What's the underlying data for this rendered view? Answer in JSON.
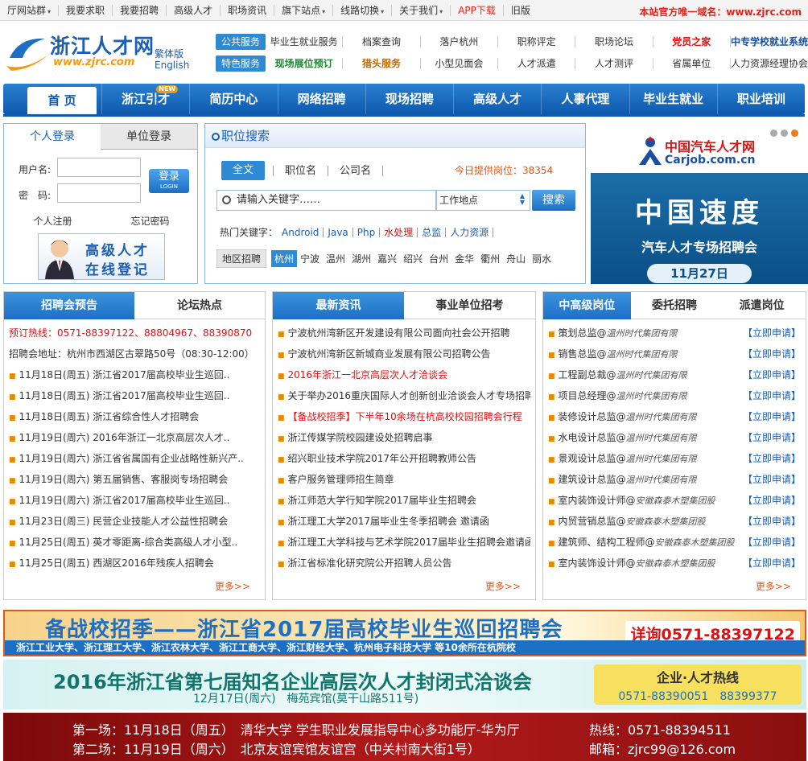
{
  "topbar": {
    "items": [
      {
        "label": "厅网站群",
        "dd": true
      },
      {
        "label": "我要求职",
        "dd": false
      },
      {
        "label": "我要招聘",
        "dd": false
      },
      {
        "label": "高级人才",
        "dd": false
      },
      {
        "label": "职场资讯",
        "dd": false
      },
      {
        "label": "旗下站点",
        "dd": true
      },
      {
        "label": "线路切换",
        "dd": true
      },
      {
        "label": "关于我们",
        "dd": true
      },
      {
        "label": "APP下载",
        "dd": false
      },
      {
        "label": "旧版",
        "dd": false
      }
    ],
    "domain_notice": "本站官方唯一域名：www.zjrc.com"
  },
  "logo": {
    "name": "浙江人才网",
    "url": "www.zjrc.com",
    "trad": "繁体版",
    "eng": "English"
  },
  "services": {
    "row1_tag": "公共服务",
    "row1": [
      "毕业生就业服务",
      "档案查询",
      "落户杭州",
      "职称评定",
      "职场论坛",
      "党员之家",
      "中专学校就业系统"
    ],
    "row2_tag": "特色服务",
    "row2": [
      "现场展位预订",
      "猎头服务",
      "小型见面会",
      "人才派遣",
      "人才测评",
      "省属单位",
      "人力资源经理协会"
    ]
  },
  "nav": {
    "items": [
      "首 页",
      "浙江引才",
      "简历中心",
      "网络招聘",
      "现场招聘",
      "高级人才",
      "人事代理",
      "毕业生就业",
      "职业培训"
    ],
    "new_badge": "NEW"
  },
  "login": {
    "tabs": [
      "个人登录",
      "单位登录"
    ],
    "user_label": "用户名:",
    "pass_label": "密　码:",
    "button": "登录",
    "button_sub": "LOGIN",
    "register": "个人注册",
    "forgot": "忘记密码",
    "banner_line1": "高级人才",
    "banner_line2": "在线登记"
  },
  "search": {
    "title": "职位搜索",
    "tabs": [
      "全文",
      "职位名",
      "公司名"
    ],
    "count_label": "今日提供岗位：",
    "count": "38354",
    "placeholder": "请输入关键字……",
    "location": "工作地点",
    "button": "搜索",
    "hot_label": "热门关键字：",
    "hot": [
      "Android",
      "Java",
      "Php",
      "水处理",
      "总监",
      "人力资源"
    ],
    "hot_red": [
      false,
      false,
      false,
      true,
      false,
      false
    ],
    "region_label": "地区招聘",
    "regions": [
      "杭州",
      "宁波",
      "温州",
      "湖州",
      "嘉兴",
      "绍兴",
      "台州",
      "金华",
      "衢州",
      "舟山",
      "丽水"
    ]
  },
  "ad": {
    "brand": "中国汽车人才网",
    "brand_url": "Carjob.com.cn",
    "title": "中国速度",
    "subtitle": "汽车人才专场招聘会",
    "date": "11月27日"
  },
  "panel1": {
    "tabs": [
      "招聘会预告",
      "论坛热点"
    ],
    "hotline": "预订热线：0571-88397122、88804967、88390870",
    "address": "招聘会地址：杭州市西湖区古翠路50号（08:30-12:00）",
    "rows": [
      "11月18日(周五) 浙江省2017届高校毕业生巡回..",
      "11月18日(周五) 浙江省2017届高校毕业生巡回..",
      "11月18日(周五) 浙江省综合性人才招聘会",
      "11月19日(周六) 2016年浙江一北京高层次人才..",
      "11月19日(周六) 浙江省省属国有企业战略性新兴产..",
      "11月19日(周六) 第五届销售、客服岗专场招聘会",
      "11月19日(周六) 浙江省2017届高校毕业生巡回..",
      "11月23日(周三) 民营企业技能人才公益性招聘会",
      "11月25日(周五) 英才零距离-综合类高级人才小型..",
      "11月25日(周五) 西湖区2016年残疾人招聘会"
    ],
    "more": "更多>>"
  },
  "panel2": {
    "tabs": [
      "最新资讯",
      "事业单位招考"
    ],
    "rows": [
      "宁波杭州湾新区开发建设有限公司面向社会公开招聘",
      "宁波杭州湾新区新城商业发展有限公司招聘公告",
      "2016年浙江一北京高层次人才洽谈会",
      "关于举办2016重庆国际人才创新创业洽谈会人才专场招聘",
      "【备战校招季】下半年10余场在杭高校校园招聘会行程",
      "浙江传媒学院校园建设处招聘启事",
      "绍兴职业技术学院2017年公开招聘教师公告",
      "客户服务管理师招生简章",
      "浙江师范大学行知学院2017届毕业生招聘会",
      "浙江理工大学2017届毕业生冬季招聘会 邀请函",
      "浙江理工大学科技与艺术学院2017届毕业生招聘会邀请函",
      "浙江省标准化研究院公开招聘人员公告"
    ],
    "red": [
      false,
      false,
      true,
      false,
      true,
      false,
      false,
      false,
      false,
      false,
      false,
      false
    ],
    "more": "更多>>"
  },
  "panel3": {
    "tabs": [
      "中高级岗位",
      "委托招聘",
      "派遣岗位"
    ],
    "apply": "【立即申请】",
    "rows": [
      {
        "job": "策划总监",
        "co": "温州时代集团有限"
      },
      {
        "job": "销售总监",
        "co": "温州时代集团有限"
      },
      {
        "job": "工程副总裁",
        "co": "温州时代集团有限"
      },
      {
        "job": "项目总经理",
        "co": "温州时代集团有限"
      },
      {
        "job": "装修设计总监",
        "co": "温州时代集团有限"
      },
      {
        "job": "水电设计总监",
        "co": "温州时代集团有限"
      },
      {
        "job": "景观设计总监",
        "co": "温州时代集团有限"
      },
      {
        "job": "建筑设计总监",
        "co": "温州时代集团有限"
      },
      {
        "job": "室内装饰设计师",
        "co": "安徽森泰木塑集团股"
      },
      {
        "job": "内贸营销总监",
        "co": "安徽森泰木塑集团股"
      },
      {
        "job": "建筑师、结构工程师",
        "co": "安徽森泰木塑集团股"
      },
      {
        "job": "室内装饰设计师",
        "co": "安徽森泰木塑集团股"
      }
    ],
    "more": "更多>>"
  },
  "banner1": {
    "title": "备战校招季——浙江省2017届高校毕业生巡回招聘会",
    "contact": "详询0571-88397122",
    "schools": "浙江工业大学、浙江理工大学、浙江农林大学、浙江工商大学、浙江财经大学、杭州电子科技大学 等10余所在杭院校"
  },
  "banner2": {
    "title": "2016年浙江省第七届知名企业高层次人才封闭式洽谈会",
    "date": "12月17日(周六)　梅苑宾馆(莫干山路511号)",
    "hotline_title": "企业·人才热线",
    "hotline": "0571-88390051　88399377"
  },
  "banner3": {
    "line1": "第一场：11月18日（周五）　清华大学 学生职业发展指导中心多功能厅-华为厅",
    "line2": "第二场：11月19日（周六）　北京友谊宾馆友谊宫（中关村南大街1号）",
    "hotline": "热线：0571-88394511",
    "email": "邮箱：zjrc99@126.com"
  }
}
